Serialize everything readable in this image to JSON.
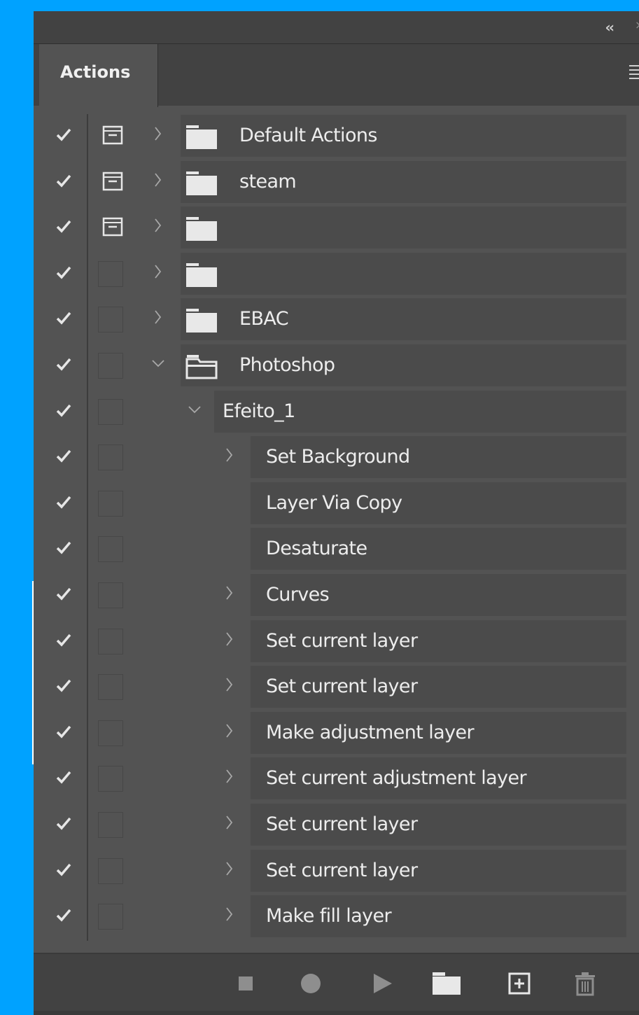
{
  "panel": {
    "tab_label": "Actions"
  },
  "colors": {
    "background": "#00a2ff",
    "panel": "#535353",
    "header": "#424242",
    "row_highlight": "#4b4b4b",
    "text": "#ededed"
  },
  "rows": [
    {
      "label": "Default Actions",
      "kind": "set",
      "expanded": false,
      "checked": true,
      "dialog": true
    },
    {
      "label": "steam",
      "kind": "set",
      "expanded": false,
      "checked": true,
      "dialog": true
    },
    {
      "label": "",
      "kind": "set",
      "expanded": false,
      "checked": true,
      "dialog": true
    },
    {
      "label": "",
      "kind": "set",
      "expanded": false,
      "checked": true,
      "dialog": false
    },
    {
      "label": "EBAC",
      "kind": "set",
      "expanded": false,
      "checked": true,
      "dialog": false
    },
    {
      "label": "Photoshop",
      "kind": "set",
      "expanded": true,
      "checked": true,
      "dialog": false
    },
    {
      "label": "Efeito_1",
      "kind": "action",
      "expanded": true,
      "checked": true,
      "dialog": false
    },
    {
      "label": "Set Background",
      "kind": "command",
      "has_chevron": true,
      "checked": true,
      "dialog": false
    },
    {
      "label": "Layer Via Copy",
      "kind": "command",
      "has_chevron": false,
      "checked": true,
      "dialog": false
    },
    {
      "label": "Desaturate",
      "kind": "command",
      "has_chevron": false,
      "checked": true,
      "dialog": false
    },
    {
      "label": "Curves",
      "kind": "command",
      "has_chevron": true,
      "checked": true,
      "dialog": false
    },
    {
      "label": "Set current layer",
      "kind": "command",
      "has_chevron": true,
      "checked": true,
      "dialog": false
    },
    {
      "label": "Set current layer",
      "kind": "command",
      "has_chevron": true,
      "checked": true,
      "dialog": false
    },
    {
      "label": "Make adjustment layer",
      "kind": "command",
      "has_chevron": true,
      "checked": true,
      "dialog": false
    },
    {
      "label": "Set current adjustment layer",
      "kind": "command",
      "has_chevron": true,
      "checked": true,
      "dialog": false
    },
    {
      "label": "Set current layer",
      "kind": "command",
      "has_chevron": true,
      "checked": true,
      "dialog": false
    },
    {
      "label": "Set current layer",
      "kind": "command",
      "has_chevron": true,
      "checked": true,
      "dialog": false
    },
    {
      "label": "Make fill layer",
      "kind": "command",
      "has_chevron": true,
      "checked": true,
      "dialog": false
    }
  ],
  "bottom_toolbar": {
    "buttons": [
      "stop-icon",
      "record-icon",
      "play-icon",
      "new-set-folder-icon",
      "new-action-icon",
      "delete-icon"
    ]
  }
}
